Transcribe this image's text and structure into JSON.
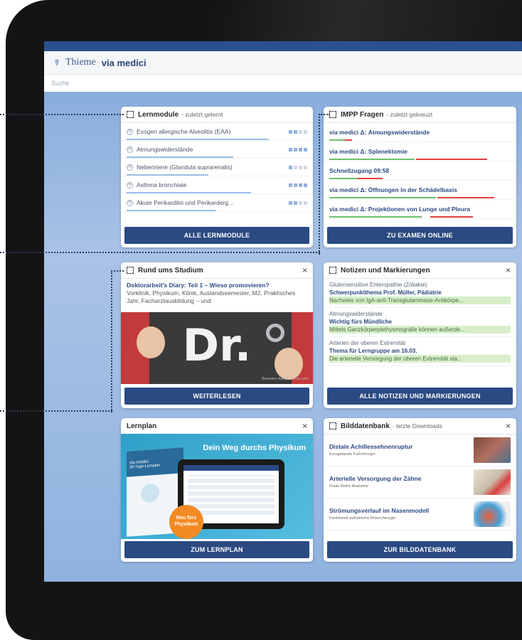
{
  "app": {
    "brand": "Thieme",
    "product": "via medici",
    "search_placeholder": "Suche"
  },
  "lernmodule": {
    "title": "Lernmodule",
    "subtitle": "- zuletzt gelernt",
    "items": [
      {
        "label": "Exogen allergische Alveolitis (EAA)",
        "progress": 0.8
      },
      {
        "label": "Atmungswiderstände",
        "progress": 0.6
      },
      {
        "label": "Nebenniere (Glandula suprarenalis)",
        "progress": 0.45
      },
      {
        "label": "Asthma bronchiale",
        "progress": 0.7
      },
      {
        "label": "Akute Perikarditis und Perikarderg...",
        "progress": 0.5
      }
    ],
    "button": "ALLE LERNMODULE"
  },
  "impp": {
    "title": "IMPP Fragen",
    "subtitle": "- zuletzt gekreuzt",
    "items": [
      {
        "label": "via medici Δ: Atmungswiderstände",
        "correct": 0.12,
        "wrong": 0.1
      },
      {
        "label": "via medici Δ: Splenektomie",
        "correct": 0.45,
        "wrong": 0.35
      },
      {
        "label": "Schnellzugang 09:58",
        "correct": 0.2,
        "wrong": 0.15
      },
      {
        "label": "via medici Δ: Öffnungen in der Schädelbasis",
        "correct": 0.55,
        "wrong": 0.35
      },
      {
        "label": "via medici Δ: Projektionen von Lunge und Pleura",
        "correct": 0.5,
        "wrong": 0.2
      }
    ],
    "button": "ZU EXAMEN ONLINE"
  },
  "studium": {
    "title": "Rund ums Studium",
    "headline": "Doktorarbeit's Diary: Teil 1 – Wieso promovieren?",
    "teaser": "Vorklinik, Physikum, Klinik, Auslandssemester, M2, Praktisches Jahr, Facharztausbildung – und",
    "image_text": "Dr.",
    "image_credit": "Brandon-Adobe.Stock.com",
    "button": "WEITERLESEN"
  },
  "notizen": {
    "title": "Notizen und Markierungen",
    "items": [
      {
        "topic": "Glutensensitive Enteropathie (Zöliakie)",
        "note": "Schwerpunktthema Prof. Müller, Pädiatrie",
        "mark": "Nachweis von IgA-anti-Transglutaminase-Antikörpe..."
      },
      {
        "topic": "Atmungswiderstände",
        "note": "Wichtig fürs Mündliche",
        "mark": "Mittels Ganzkörperplethysmografie können außerde..."
      },
      {
        "topic": "Arterien der oberen Extremität",
        "note": "Thema für Lerngruppe am 16.03.",
        "mark": "Die arterielle Versorgung der oberen Extremität sta..."
      }
    ],
    "button": "ALLE NOTIZEN UND MARKIERUNGEN"
  },
  "lernplan": {
    "title": "Lernplan",
    "banner": "Dein Weg durchs Physikum",
    "book_title": "via medici",
    "book_sub": "30-Tage-Lernplan",
    "badge_line1": "Neu fürs",
    "badge_line2": "Physikum",
    "button": "ZUM LERNPLAN"
  },
  "bilddatenbank": {
    "title": "Bilddatenbank",
    "subtitle": "- letzte Downloads",
    "items": [
      {
        "title": "Distale Achillessehnenruptur",
        "source": "Kurzgefasste Fußchirurgie"
      },
      {
        "title": "Arterielle Versorgung der Zähne",
        "source": "Duale Reihe Anatomie"
      },
      {
        "title": "Strömungsverlauf im Nasenmodell",
        "source": "Funktionell-ästhetische Rhinochirurgie"
      }
    ],
    "button": "ZUR BILDDATENBANK"
  },
  "ui": {
    "close_glyph": "×",
    "accent": "#2a4a82",
    "progress_color": "#9cbfe8"
  }
}
